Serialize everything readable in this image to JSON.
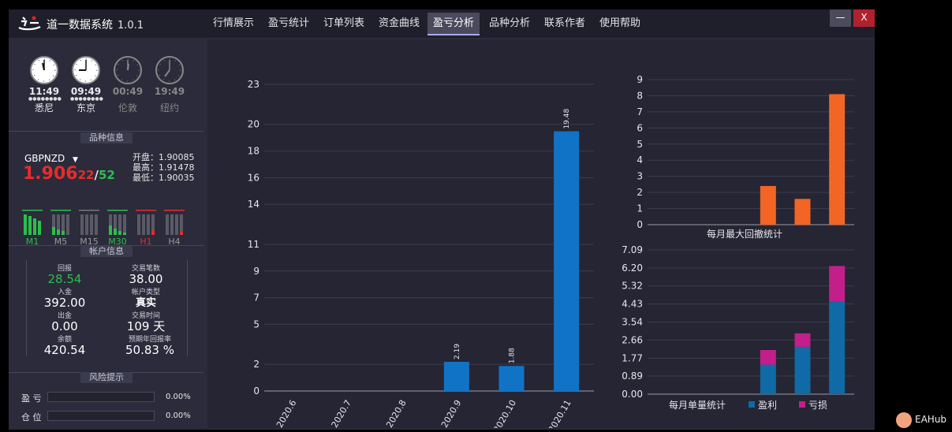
{
  "app": {
    "title": "道一数据系统",
    "version": "1.0.1"
  },
  "tabs": [
    {
      "label": "行情展示",
      "active": false
    },
    {
      "label": "盈亏统计",
      "active": false
    },
    {
      "label": "订单列表",
      "active": false
    },
    {
      "label": "资金曲线",
      "active": false
    },
    {
      "label": "盈亏分析",
      "active": true
    },
    {
      "label": "品种分析",
      "active": false
    },
    {
      "label": "联系作者",
      "active": false
    },
    {
      "label": "使用帮助",
      "active": false
    }
  ],
  "window_buttons": {
    "minimize": "—",
    "close": "X"
  },
  "clocks": [
    {
      "time": "11:49",
      "city": "悉尼",
      "active": true
    },
    {
      "time": "09:49",
      "city": "东京",
      "active": true
    },
    {
      "time": "00:49",
      "city": "伦敦",
      "active": false
    },
    {
      "time": "19:49",
      "city": "纽约",
      "active": false
    }
  ],
  "symbol_section": {
    "label": "品种信息",
    "symbol": "GBPNZD",
    "bid_main": "1.906",
    "bid_small": "22",
    "separator": "/",
    "ask_small": "52",
    "open": "开盘：1.90085",
    "high": "最高：1.91478",
    "low": "最低：1.90035",
    "timeframes": [
      "M1",
      "M5",
      "M15",
      "M30",
      "H1",
      "H4"
    ]
  },
  "account_section": {
    "label": "帐户信息",
    "items": [
      {
        "key": "回报",
        "value": "28.54"
      },
      {
        "key": "交易笔数",
        "value": "38.00"
      },
      {
        "key": "入金",
        "value": "392.00"
      },
      {
        "key": "帐户类型",
        "value": "真实"
      },
      {
        "key": "出金",
        "value": "0.00"
      },
      {
        "key": "交易时间",
        "value": "109 天"
      },
      {
        "key": "余额",
        "value": "420.54"
      },
      {
        "key": "预期年回报率",
        "value": "50.83 %"
      }
    ]
  },
  "risk_section": {
    "label": "风险提示",
    "rows": [
      {
        "label": "盈 亏",
        "value": "0.00%",
        "level": 0
      },
      {
        "label": "仓 位",
        "value": "0.00%",
        "level": 0
      }
    ]
  },
  "colors": {
    "bar_blue": "#1173c6",
    "bar_orange": "#f26524",
    "loss_magenta": "#c21f8a",
    "win_blue": "#0f6aa6",
    "green": "#2bbf4c",
    "red": "#e82c2c"
  },
  "badge": {
    "text": "EAHub",
    "icon": "eahub-logo-icon"
  },
  "chart_data": [
    {
      "type": "bar",
      "categories": [
        "2020.6",
        "2020.7",
        "2020.8",
        "2020.9",
        "2020.10",
        "2020.11"
      ],
      "values": [
        0,
        0,
        0,
        2.19,
        1.88,
        19.48
      ],
      "data_labels": [
        "",
        "",
        "",
        "2.19",
        "1.88",
        "19.48"
      ],
      "ylim": [
        0,
        23
      ],
      "yticks": [
        "0",
        "2",
        "5",
        "7",
        "9",
        "11",
        "14",
        "16",
        "18",
        "20",
        "23"
      ],
      "grid": true,
      "color": "#1173c6"
    },
    {
      "type": "bar",
      "title": "每月最大回撤统计",
      "categories": [
        "2020.6",
        "2020.7",
        "2020.8",
        "2020.9",
        "2020.10",
        "2020.11"
      ],
      "values": [
        0,
        0,
        0,
        2.4,
        1.6,
        8.1
      ],
      "ylim": [
        0,
        9
      ],
      "yticks": [
        "0",
        "1",
        "2",
        "3",
        "4",
        "5",
        "6",
        "7",
        "8",
        "9"
      ],
      "grid": true,
      "color": "#f26524"
    },
    {
      "type": "bar",
      "stacked": true,
      "title": "每月单量统计",
      "categories": [
        "2020.6",
        "2020.7",
        "2020.8",
        "2020.9",
        "2020.10",
        "2020.11"
      ],
      "series": [
        {
          "name": "盈利",
          "color": "#0f6aa6",
          "values": [
            0,
            0,
            0,
            1.45,
            2.33,
            4.55
          ]
        },
        {
          "name": "亏损",
          "color": "#c21f8a",
          "values": [
            0,
            0,
            0,
            0.72,
            0.66,
            1.75
          ]
        }
      ],
      "ylim": [
        0,
        7.09
      ],
      "yticks": [
        "0.00",
        "0.89",
        "1.77",
        "2.66",
        "3.54",
        "4.43",
        "5.32",
        "6.20",
        "7.09"
      ],
      "legend": "bottom",
      "grid": true
    }
  ]
}
